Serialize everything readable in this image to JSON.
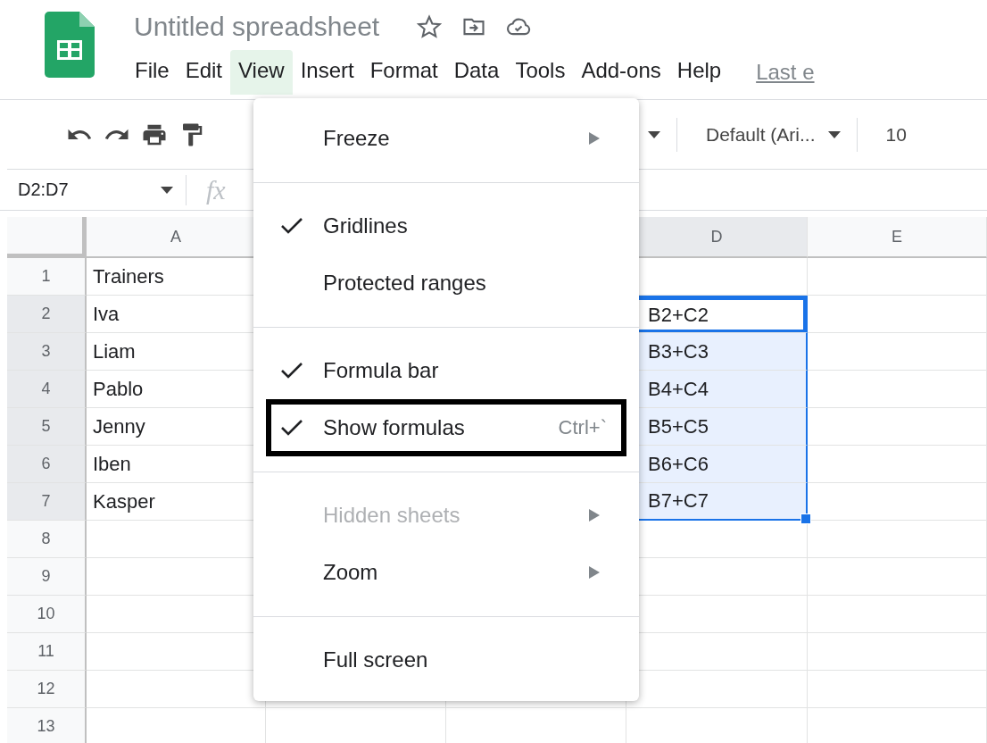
{
  "header": {
    "title": "Untitled spreadsheet",
    "menus": [
      {
        "label": "File",
        "selected": false
      },
      {
        "label": "Edit",
        "selected": false
      },
      {
        "label": "View",
        "selected": true
      },
      {
        "label": "Insert",
        "selected": false
      },
      {
        "label": "Format",
        "selected": false
      },
      {
        "label": "Data",
        "selected": false
      },
      {
        "label": "Tools",
        "selected": false
      },
      {
        "label": "Add-ons",
        "selected": false
      },
      {
        "label": "Help",
        "selected": false
      }
    ],
    "last_edit_link": "Last e"
  },
  "toolbar": {
    "font": "Default (Ari...",
    "font_size": "10"
  },
  "formula_bar": {
    "name_box": "D2:D7",
    "fx_label": "fx"
  },
  "grid": {
    "columns": [
      {
        "kind": "header",
        "label": "A",
        "selected": false
      },
      {
        "kind": "covered"
      },
      {
        "kind": "covered"
      },
      {
        "kind": "header",
        "label": "D",
        "selected": true
      },
      {
        "kind": "header",
        "label": "E",
        "selected": false
      }
    ],
    "rows": [
      {
        "number": "1",
        "selected": false,
        "active": false,
        "a": "Trainers"
      },
      {
        "number": "2",
        "selected": true,
        "active": true,
        "a": "Iva",
        "d": "B2+C2"
      },
      {
        "number": "3",
        "selected": true,
        "active": false,
        "a": "Liam",
        "d": "B3+C3"
      },
      {
        "number": "4",
        "selected": true,
        "active": false,
        "a": "Pablo",
        "d": "B4+C4"
      },
      {
        "number": "5",
        "selected": true,
        "active": false,
        "a": "Jenny",
        "d": "B5+C5"
      },
      {
        "number": "6",
        "selected": true,
        "active": false,
        "a": "Iben",
        "d": "B6+C6"
      },
      {
        "number": "7",
        "selected": true,
        "active": false,
        "a": "Kasper",
        "d": "B7+C7"
      },
      {
        "number": "8",
        "selected": false,
        "active": false
      },
      {
        "number": "9",
        "selected": false,
        "active": false
      },
      {
        "number": "10",
        "selected": false,
        "active": false
      },
      {
        "number": "11",
        "selected": false,
        "active": false
      },
      {
        "number": "12",
        "selected": false,
        "active": false
      },
      {
        "number": "13",
        "selected": false,
        "active": false
      }
    ]
  },
  "view_menu": {
    "items": [
      {
        "kind": "item",
        "label": "Freeze",
        "checked": false,
        "disabled": false,
        "submenu": true,
        "outlined": false
      },
      {
        "kind": "divider"
      },
      {
        "kind": "item",
        "label": "Gridlines",
        "checked": true,
        "disabled": false,
        "submenu": false,
        "outlined": false
      },
      {
        "kind": "item",
        "label": "Protected ranges",
        "checked": false,
        "disabled": false,
        "submenu": false,
        "outlined": false
      },
      {
        "kind": "divider"
      },
      {
        "kind": "item",
        "label": "Formula bar",
        "checked": true,
        "disabled": false,
        "submenu": false,
        "outlined": false
      },
      {
        "kind": "item",
        "label": "Show formulas",
        "checked": true,
        "disabled": false,
        "submenu": false,
        "outlined": true,
        "shortcut": "Ctrl+`"
      },
      {
        "kind": "divider"
      },
      {
        "kind": "item",
        "label": "Hidden sheets",
        "checked": false,
        "disabled": true,
        "submenu": true,
        "outlined": false
      },
      {
        "kind": "item",
        "label": "Zoom",
        "checked": false,
        "disabled": false,
        "submenu": true,
        "outlined": false
      },
      {
        "kind": "divider"
      },
      {
        "kind": "item",
        "label": "Full screen",
        "checked": false,
        "disabled": false,
        "submenu": false,
        "outlined": false
      }
    ]
  }
}
